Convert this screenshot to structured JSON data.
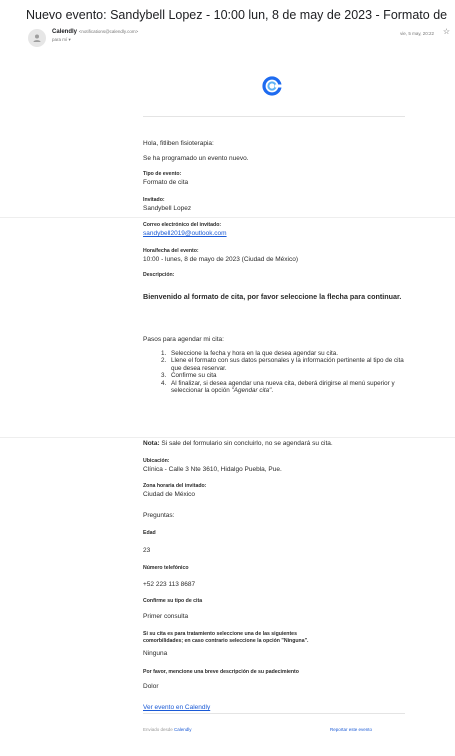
{
  "subject": "Nuevo evento: Sandybell Lopez - 10:00 lun, 8 de may de 2023 - Formato de cita",
  "sender": {
    "name": "Calendly",
    "email": "<notifications@calendly.com>",
    "to": "para mí ▾",
    "date": "vie, 5 may, 20:22"
  },
  "icons": {
    "avatar": "person-icon",
    "star": "star-icon",
    "logo": "calendly-logo"
  },
  "colors": {
    "link": "#1a5ad6",
    "logo": "#1e6bf0"
  },
  "body": {
    "greeting": "Hola, fitliben fisioterapia:",
    "intro": "Se ha programado un evento nuevo.",
    "event_type_label": "Tipo de evento:",
    "event_type": "Formato de cita",
    "invitee_label": "Invitado:",
    "invitee": "Sandybell Lopez",
    "email_label": "Correo electrónico del invitado:",
    "email": "sandybell2019@outlook.com",
    "datetime_label": "Hora/fecha del evento:",
    "datetime": "10:00 - lunes, 8 de mayo de 2023 (Ciudad de México)",
    "description_label": "Descripción:",
    "welcome": "Bienvenido al formato de cita, por favor seleccione la flecha para continuar.",
    "steps_title": "Pasos para agendar mi cita:",
    "steps": [
      {
        "num": "1.",
        "text": "Seleccione la fecha y hora en la que desea agendar su cita."
      },
      {
        "num": "2.",
        "text": "Llene el formato con sus datos personales y la información pertinente al tipo de cita que desea reservar."
      },
      {
        "num": "3.",
        "text": "Confirme su cita"
      },
      {
        "num": "4.",
        "text": "Al finalizar, si desea agendar una nueva cita, deberá dirigirse al menú superior y seleccionar la opción ",
        "italic": "\"Agendar cita\"",
        "end": "."
      }
    ],
    "note_bold": "Nota:",
    "note": " Si sale del formulario sin concluirlo, no se agendará su cita.",
    "location_label": "Ubicación:",
    "location": "Clínica - Calle 3 Nte 3610, Hidalgo Puebla, Pue.",
    "timezone_label": "Zona horaria del invitado:",
    "timezone": "Ciudad de México",
    "questions_title": "Preguntas:",
    "q_age_label": "Edad",
    "q_age": "23",
    "q_phone_label": "Número telefónico",
    "q_phone": "+52 223 113 8687",
    "q_type_label": "Confirme su tipo de cita",
    "q_type": "Primer consulta",
    "q_comorb_label_1": "Si su cita es para tratamiento seleccione una de las siguientes",
    "q_comorb_label_2": "comorbilidades; en caso contrario seleccione la opción \"Ninguna\".",
    "q_comorb": "Ninguna",
    "q_desc_label": "Por favor, mencione una breve descripción de su padecimiento",
    "q_desc": "Dolor",
    "view_link": "Ver evento en Calendly"
  },
  "footer": {
    "left_prefix": "Enviado desde ",
    "left_link": "Calendly",
    "right_link": "Reportar este evento"
  }
}
